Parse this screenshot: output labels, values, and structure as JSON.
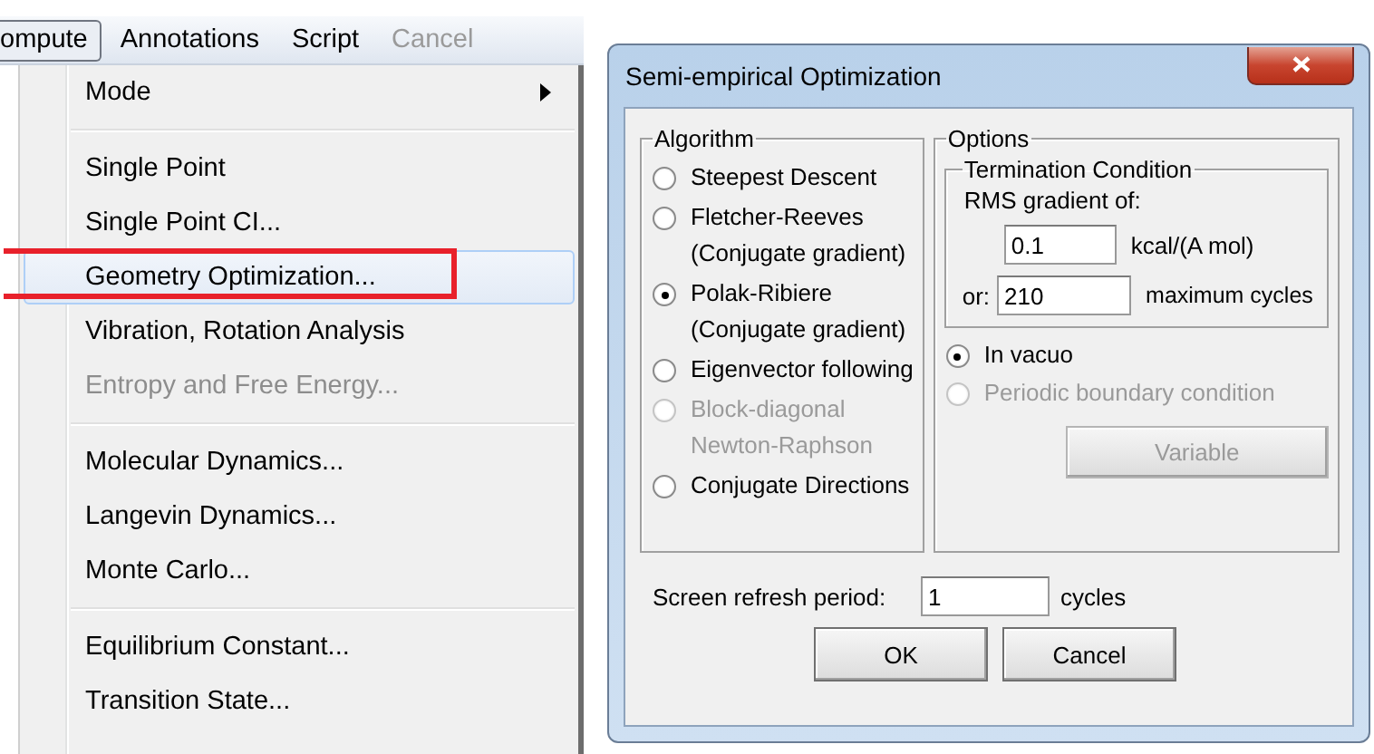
{
  "menubar": [
    {
      "label": "ompute",
      "selected": true,
      "disabled": false
    },
    {
      "label": "Annotations",
      "selected": false,
      "disabled": false
    },
    {
      "label": "Script",
      "selected": false,
      "disabled": false
    },
    {
      "label": "Cancel",
      "selected": false,
      "disabled": true
    }
  ],
  "menu": {
    "groups": [
      [
        {
          "label": "Mode",
          "submenu": true,
          "disabled": false,
          "selected": false,
          "annotated": false
        }
      ],
      [
        {
          "label": "Single Point",
          "submenu": false,
          "disabled": false,
          "selected": false,
          "annotated": false
        },
        {
          "label": "Single Point CI...",
          "submenu": false,
          "disabled": false,
          "selected": false,
          "annotated": false
        },
        {
          "label": "Geometry Optimization...",
          "submenu": false,
          "disabled": false,
          "selected": true,
          "annotated": true
        },
        {
          "label": "Vibration, Rotation Analysis",
          "submenu": false,
          "disabled": false,
          "selected": false,
          "annotated": false
        },
        {
          "label": "Entropy and Free Energy...",
          "submenu": false,
          "disabled": true,
          "selected": false,
          "annotated": false
        }
      ],
      [
        {
          "label": "Molecular Dynamics...",
          "submenu": false,
          "disabled": false,
          "selected": false,
          "annotated": false
        },
        {
          "label": "Langevin Dynamics...",
          "submenu": false,
          "disabled": false,
          "selected": false,
          "annotated": false
        },
        {
          "label": "Monte Carlo...",
          "submenu": false,
          "disabled": false,
          "selected": false,
          "annotated": false
        }
      ],
      [
        {
          "label": "Equilibrium Constant...",
          "submenu": false,
          "disabled": false,
          "selected": false,
          "annotated": false
        },
        {
          "label": "Transition State...",
          "submenu": false,
          "disabled": false,
          "selected": false,
          "annotated": false
        }
      ]
    ]
  },
  "dialog": {
    "title": "Semi-empirical Optimization",
    "algorithm": {
      "title": "Algorithm",
      "options": [
        {
          "lines": [
            "Steepest Descent"
          ],
          "selected": false,
          "disabled": false
        },
        {
          "lines": [
            "Fletcher-Reeves",
            "(Conjugate gradient)"
          ],
          "selected": false,
          "disabled": false
        },
        {
          "lines": [
            "Polak-Ribiere",
            "(Conjugate gradient)"
          ],
          "selected": true,
          "disabled": false
        },
        {
          "lines": [
            "Eigenvector following"
          ],
          "selected": false,
          "disabled": false
        },
        {
          "lines": [
            "Block-diagonal",
            "Newton-Raphson"
          ],
          "selected": false,
          "disabled": true
        },
        {
          "lines": [
            "Conjugate Directions"
          ],
          "selected": false,
          "disabled": false
        }
      ]
    },
    "options": {
      "title": "Options",
      "termination": {
        "title": "Termination Condition",
        "rms_label": "RMS gradient of:",
        "rms_value": "0.1",
        "rms_unit": "kcal/(A mol)",
        "or_label": "or:",
        "cycles_value": "210",
        "cycles_unit": "maximum cycles"
      },
      "environment": [
        {
          "label": "In vacuo",
          "selected": true,
          "disabled": false
        },
        {
          "label": "Periodic boundary condition",
          "selected": false,
          "disabled": true
        }
      ],
      "variable_button": {
        "label": "Variable",
        "disabled": true
      }
    },
    "refresh": {
      "label": "Screen refresh period:",
      "value": "1",
      "unit": "cycles"
    },
    "buttons": [
      {
        "label": "OK"
      },
      {
        "label": "Cancel"
      }
    ]
  }
}
